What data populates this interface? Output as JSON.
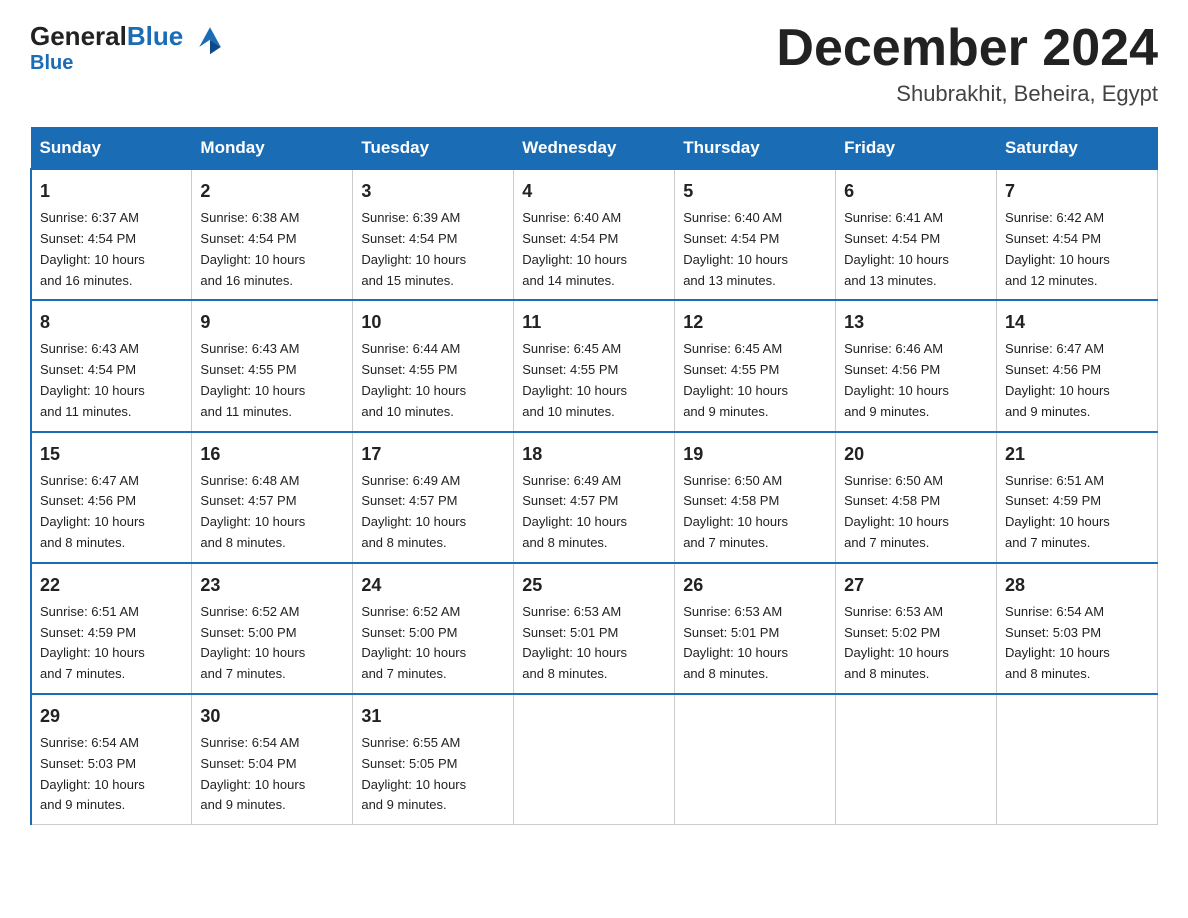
{
  "header": {
    "logo_text_general": "General",
    "logo_text_blue": "Blue",
    "month_title": "December 2024",
    "location": "Shubrakhit, Beheira, Egypt"
  },
  "days_of_week": [
    "Sunday",
    "Monday",
    "Tuesday",
    "Wednesday",
    "Thursday",
    "Friday",
    "Saturday"
  ],
  "weeks": [
    [
      {
        "day": "1",
        "sunrise": "6:37 AM",
        "sunset": "4:54 PM",
        "daylight": "10 hours and 16 minutes."
      },
      {
        "day": "2",
        "sunrise": "6:38 AM",
        "sunset": "4:54 PM",
        "daylight": "10 hours and 16 minutes."
      },
      {
        "day": "3",
        "sunrise": "6:39 AM",
        "sunset": "4:54 PM",
        "daylight": "10 hours and 15 minutes."
      },
      {
        "day": "4",
        "sunrise": "6:40 AM",
        "sunset": "4:54 PM",
        "daylight": "10 hours and 14 minutes."
      },
      {
        "day": "5",
        "sunrise": "6:40 AM",
        "sunset": "4:54 PM",
        "daylight": "10 hours and 13 minutes."
      },
      {
        "day": "6",
        "sunrise": "6:41 AM",
        "sunset": "4:54 PM",
        "daylight": "10 hours and 13 minutes."
      },
      {
        "day": "7",
        "sunrise": "6:42 AM",
        "sunset": "4:54 PM",
        "daylight": "10 hours and 12 minutes."
      }
    ],
    [
      {
        "day": "8",
        "sunrise": "6:43 AM",
        "sunset": "4:54 PM",
        "daylight": "10 hours and 11 minutes."
      },
      {
        "day": "9",
        "sunrise": "6:43 AM",
        "sunset": "4:55 PM",
        "daylight": "10 hours and 11 minutes."
      },
      {
        "day": "10",
        "sunrise": "6:44 AM",
        "sunset": "4:55 PM",
        "daylight": "10 hours and 10 minutes."
      },
      {
        "day": "11",
        "sunrise": "6:45 AM",
        "sunset": "4:55 PM",
        "daylight": "10 hours and 10 minutes."
      },
      {
        "day": "12",
        "sunrise": "6:45 AM",
        "sunset": "4:55 PM",
        "daylight": "10 hours and 9 minutes."
      },
      {
        "day": "13",
        "sunrise": "6:46 AM",
        "sunset": "4:56 PM",
        "daylight": "10 hours and 9 minutes."
      },
      {
        "day": "14",
        "sunrise": "6:47 AM",
        "sunset": "4:56 PM",
        "daylight": "10 hours and 9 minutes."
      }
    ],
    [
      {
        "day": "15",
        "sunrise": "6:47 AM",
        "sunset": "4:56 PM",
        "daylight": "10 hours and 8 minutes."
      },
      {
        "day": "16",
        "sunrise": "6:48 AM",
        "sunset": "4:57 PM",
        "daylight": "10 hours and 8 minutes."
      },
      {
        "day": "17",
        "sunrise": "6:49 AM",
        "sunset": "4:57 PM",
        "daylight": "10 hours and 8 minutes."
      },
      {
        "day": "18",
        "sunrise": "6:49 AM",
        "sunset": "4:57 PM",
        "daylight": "10 hours and 8 minutes."
      },
      {
        "day": "19",
        "sunrise": "6:50 AM",
        "sunset": "4:58 PM",
        "daylight": "10 hours and 7 minutes."
      },
      {
        "day": "20",
        "sunrise": "6:50 AM",
        "sunset": "4:58 PM",
        "daylight": "10 hours and 7 minutes."
      },
      {
        "day": "21",
        "sunrise": "6:51 AM",
        "sunset": "4:59 PM",
        "daylight": "10 hours and 7 minutes."
      }
    ],
    [
      {
        "day": "22",
        "sunrise": "6:51 AM",
        "sunset": "4:59 PM",
        "daylight": "10 hours and 7 minutes."
      },
      {
        "day": "23",
        "sunrise": "6:52 AM",
        "sunset": "5:00 PM",
        "daylight": "10 hours and 7 minutes."
      },
      {
        "day": "24",
        "sunrise": "6:52 AM",
        "sunset": "5:00 PM",
        "daylight": "10 hours and 7 minutes."
      },
      {
        "day": "25",
        "sunrise": "6:53 AM",
        "sunset": "5:01 PM",
        "daylight": "10 hours and 8 minutes."
      },
      {
        "day": "26",
        "sunrise": "6:53 AM",
        "sunset": "5:01 PM",
        "daylight": "10 hours and 8 minutes."
      },
      {
        "day": "27",
        "sunrise": "6:53 AM",
        "sunset": "5:02 PM",
        "daylight": "10 hours and 8 minutes."
      },
      {
        "day": "28",
        "sunrise": "6:54 AM",
        "sunset": "5:03 PM",
        "daylight": "10 hours and 8 minutes."
      }
    ],
    [
      {
        "day": "29",
        "sunrise": "6:54 AM",
        "sunset": "5:03 PM",
        "daylight": "10 hours and 9 minutes."
      },
      {
        "day": "30",
        "sunrise": "6:54 AM",
        "sunset": "5:04 PM",
        "daylight": "10 hours and 9 minutes."
      },
      {
        "day": "31",
        "sunrise": "6:55 AM",
        "sunset": "5:05 PM",
        "daylight": "10 hours and 9 minutes."
      },
      null,
      null,
      null,
      null
    ]
  ],
  "labels": {
    "sunrise": "Sunrise:",
    "sunset": "Sunset:",
    "daylight": "Daylight:"
  }
}
